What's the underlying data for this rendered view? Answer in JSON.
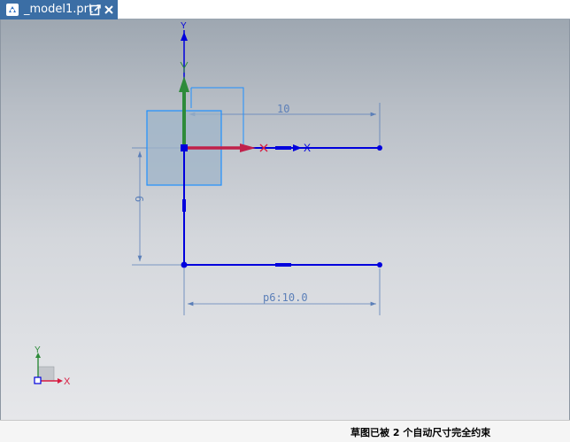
{
  "tab": {
    "title": "_model1.prt",
    "file_icon": "nx-part-file-icon",
    "popout_icon": "popout-window-icon",
    "close_icon": "close-icon"
  },
  "sketch": {
    "dimension_horizontal_top": "10",
    "dimension_vertical": "6",
    "dimension_horizontal_bottom": "p6:10.0",
    "sketch_axis_y": "Y",
    "sketch_axis_x": "X",
    "triad_axis_y": "Y",
    "triad_axis_x": "X",
    "colors": {
      "curve": "#0000dd",
      "dimension": "#5b7fb8",
      "x_axis": "#d81b40",
      "y_axis": "#2e8b3a",
      "handle_box": "#1e90ff"
    }
  },
  "status": {
    "message": "草图已被 2 个自动尺寸完全约束"
  }
}
